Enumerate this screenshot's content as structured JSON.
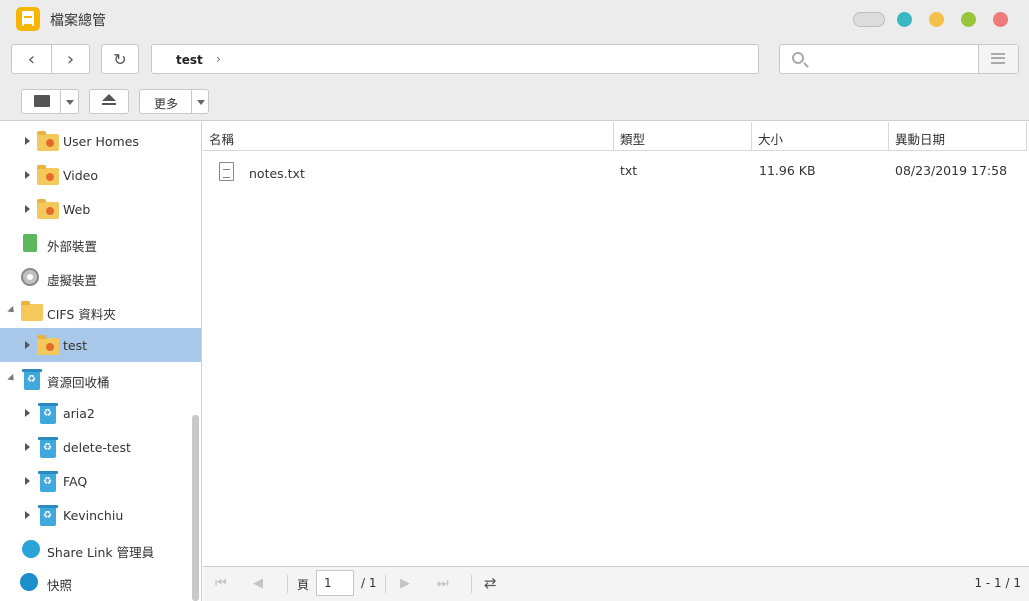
{
  "window": {
    "title": "檔案總管"
  },
  "path": {
    "segment": "test",
    "arrow": "›"
  },
  "search": {
    "placeholder": ""
  },
  "toolbar": {
    "more_label": "更多"
  },
  "sidebar": {
    "items": [
      {
        "label": "User Homes"
      },
      {
        "label": "Video"
      },
      {
        "label": "Web"
      },
      {
        "label": "外部裝置"
      },
      {
        "label": "虛擬裝置"
      },
      {
        "label": "CIFS 資料夾"
      },
      {
        "label": "test"
      },
      {
        "label": "資源回收桶"
      },
      {
        "label": "aria2"
      },
      {
        "label": "delete-test"
      },
      {
        "label": "FAQ"
      },
      {
        "label": "Kevinchiu"
      },
      {
        "label": "Share Link 管理員"
      },
      {
        "label": "快照"
      }
    ]
  },
  "table": {
    "headers": [
      "名稱",
      "類型",
      "大小",
      "異動日期"
    ],
    "rows": [
      {
        "name": "notes.txt",
        "type": "txt",
        "size": "11.96 KB",
        "modified": "08/23/2019 17:58"
      }
    ]
  },
  "footer": {
    "page_label": "頁",
    "page_value": "1",
    "page_total": "/ 1",
    "range": "1 - 1 / 1"
  },
  "colors": {
    "selected_row": "#a9c7e8",
    "app_icon": "#f7b500",
    "dot_teal": "#3ab7c1",
    "dot_yellow": "#f5c04a",
    "dot_green": "#9ac43a",
    "dot_red": "#ef7a7a"
  }
}
